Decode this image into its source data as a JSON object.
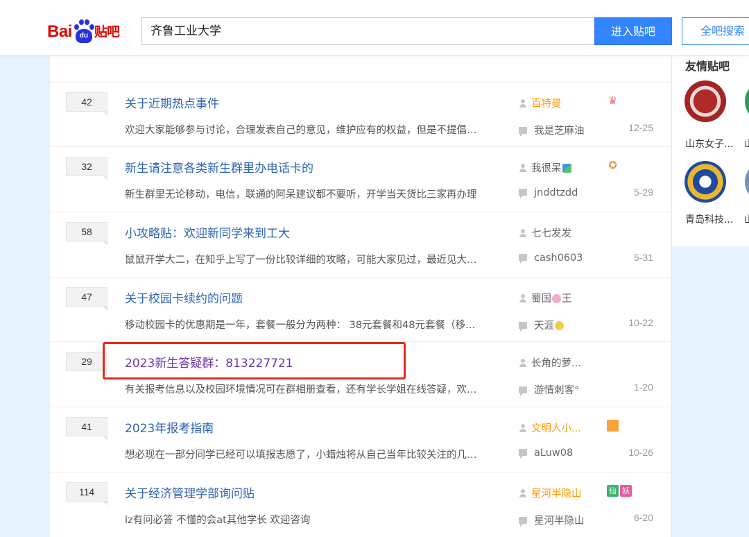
{
  "header": {
    "logo_bai": "Bai",
    "logo_du": "du",
    "logo_tieba": "贴吧",
    "search_value": "齐鲁工业大学",
    "enter_label": "进入贴吧",
    "all_search_label": "全吧搜索"
  },
  "colors": {
    "accent": "#3385ff",
    "link": "#2d64b3",
    "visited": "#6a37a8",
    "author_highlight": "#ff9900",
    "highlight_box": "#e8281c",
    "page_bg": "#e6f2fd"
  },
  "threads": [
    {
      "replies": "42",
      "title": "关于近期热点事件",
      "abstract": "欢迎大家能够参与讨论，合理发表自己的意见，维护应有的权益，但是不提倡违规和极端的言论",
      "author": "百特曼",
      "last_reply_user": "我是芝麻油",
      "time": "12-25"
    },
    {
      "replies": "32",
      "title": "新生请注意各类新生群里办电话卡的",
      "abstract": "新生群里无论移动，电信，联通的阿呆建议都不要听，开学当天货比三家再办理",
      "author": "我很呆",
      "last_reply_user": "jnddtzdd",
      "time": "5-29"
    },
    {
      "replies": "58",
      "title": "小攻略贴：欢迎新同学来到工大",
      "abstract": "鼠鼠开学大二，在知乎上写了一份比较详细的攻略，可能大家见过，最近见大家都在问",
      "author": "七七发发",
      "last_reply_user": "cash0603",
      "time": "5-31"
    },
    {
      "replies": "47",
      "title": "关于校园卡续约的问题",
      "abstract": "移动校园卡的优惠期是一年，套餐一般分为两种： 38元套餐和48元套餐（移动用户",
      "author": "蜀国",
      "author_suffix": "王",
      "last_reply_user": "天涯",
      "time": "10-22"
    },
    {
      "replies": "29",
      "title": "2023新生答疑群：813227721",
      "abstract": "有关报考信息以及校园环境情况可在群相册查看，还有学长学姐在线答疑，欢迎大家加入",
      "author": "长角的萝...",
      "last_reply_user": "游情刺客°",
      "time": "1-20"
    },
    {
      "replies": "41",
      "title": "2023年报考指南",
      "abstract": "想必现在一部分同学已经可以填报志愿了，小蜡烛将从自己当年比较关注的几个方面来说",
      "author": "文明人小...",
      "last_reply_user": "aLuw08",
      "time": "10-26"
    },
    {
      "replies": "114",
      "title": "关于经济管理学部询问贴",
      "abstract": "lz有问必答 不懂的会at其他学长 欢迎咨询",
      "author": "星河半隐山",
      "last_reply_user": "星河半隐山",
      "time": "6-20",
      "badges": [
        "仙",
        "妖"
      ]
    }
  ],
  "sidebar": {
    "title": "友情贴吧",
    "bars": [
      {
        "name": "山东女子...",
        "name2": "山"
      },
      {
        "name": "青岛科技...",
        "name2": "山"
      }
    ]
  }
}
